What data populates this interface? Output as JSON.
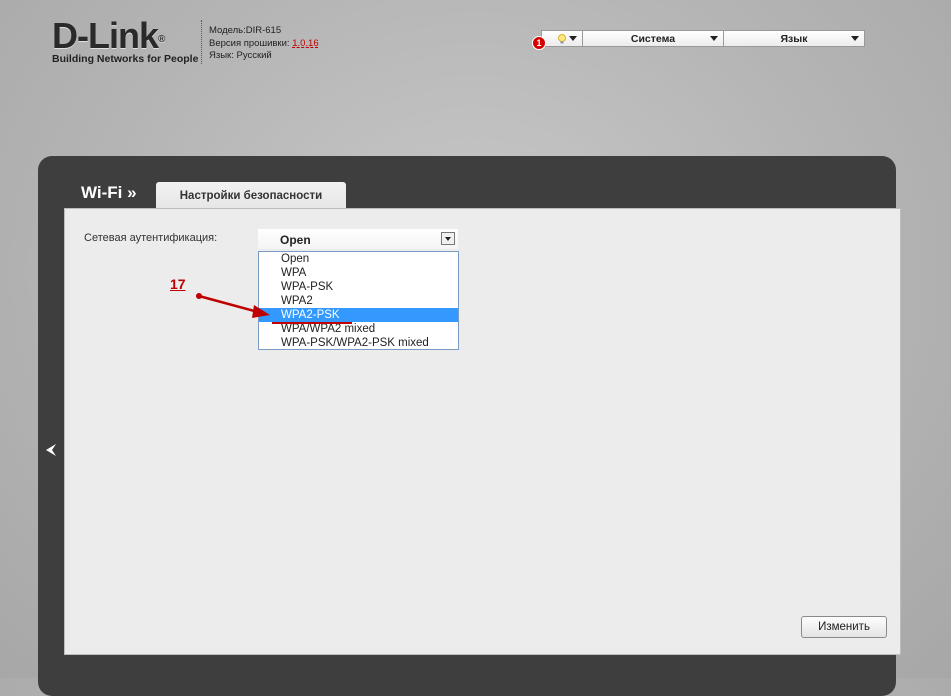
{
  "header": {
    "logo_text": "D-Link",
    "logo_reg": "®",
    "tagline": "Building Networks for People",
    "model_label": "Модель:",
    "model_value": "DIR-615",
    "firmware_label": "Версия прошивки:",
    "firmware_value": "1.0.16",
    "lang_label": "Язык:",
    "lang_value": "Русский"
  },
  "toolbar": {
    "bulb_icon": "lightbulb-icon",
    "notification_count": "1",
    "system_label": "Система",
    "language_label": "Язык"
  },
  "section": {
    "title": "Wi-Fi »",
    "active_tab": "Настройки безопасности"
  },
  "form": {
    "auth_label": "Сетевая аутентификация:",
    "auth_selected": "Open",
    "auth_options": [
      "Open",
      "WPA",
      "WPA-PSK",
      "WPA2",
      "WPA2-PSK",
      "WPA/WPA2 mixed",
      "WPA-PSK/WPA2-PSK mixed"
    ],
    "highlighted_option": "WPA2-PSK",
    "change_button": "Изменить"
  },
  "annotation": {
    "step_number": "17",
    "color": "#c00000"
  },
  "colors": {
    "frame": "#3e3e3e",
    "panel": "#ececec",
    "selection": "#3399ff",
    "accent_red": "#c00000"
  }
}
